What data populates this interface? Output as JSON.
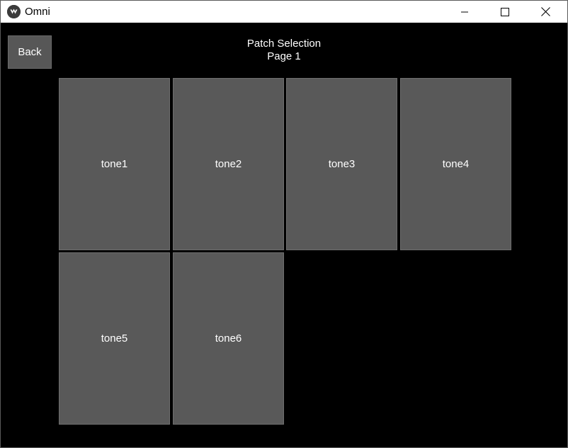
{
  "window": {
    "title": "Omni",
    "icons": {
      "app": "kivy-app-icon",
      "minimize": "minimize-icon",
      "maximize": "maximize-icon",
      "close": "close-icon"
    }
  },
  "toolbar": {
    "back_label": "Back"
  },
  "header": {
    "title": "Patch Selection",
    "page": "Page 1"
  },
  "patches": [
    {
      "label": "tone1"
    },
    {
      "label": "tone2"
    },
    {
      "label": "tone3"
    },
    {
      "label": "tone4"
    },
    {
      "label": "tone5"
    },
    {
      "label": "tone6"
    }
  ],
  "colors": {
    "background": "#000000",
    "tile": "#595959",
    "button": "#575757",
    "text": "#ffffff"
  }
}
